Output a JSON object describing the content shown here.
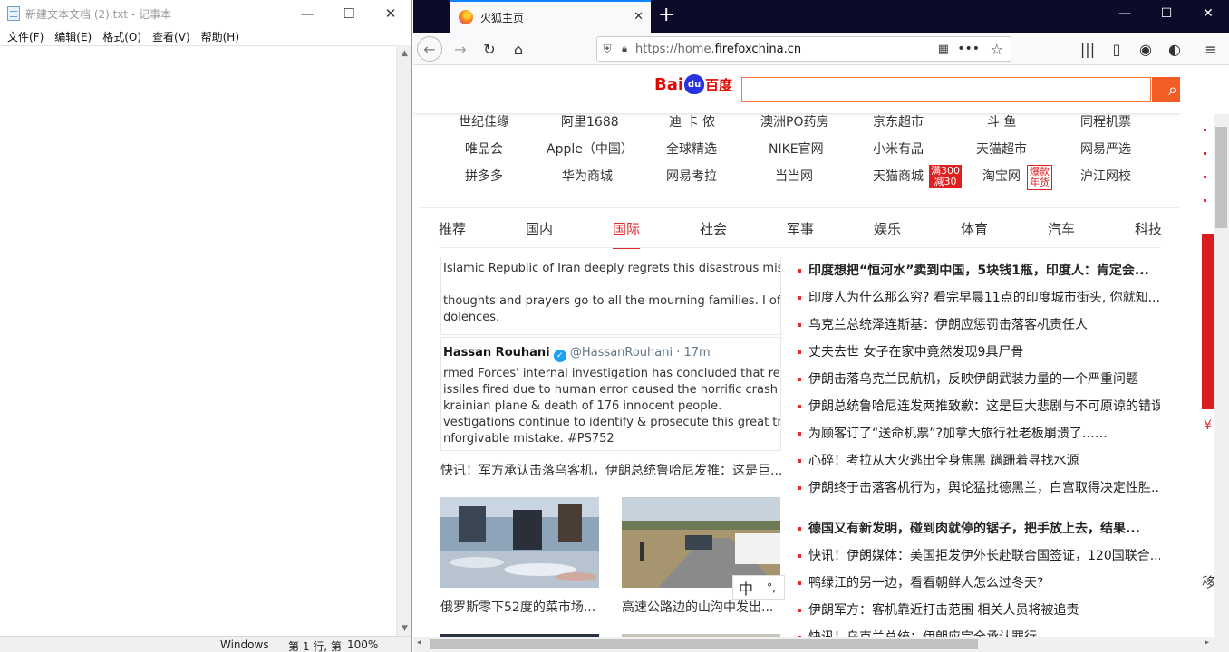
{
  "notepad": {
    "title": "新建文本文档 (2).txt - 记事本",
    "menu": [
      "文件(F)",
      "编辑(E)",
      "格式(O)",
      "查看(V)",
      "帮助(H)"
    ],
    "status": {
      "encoding": "Windows (",
      "position": "第 1 行, 第",
      "zoom": "100%"
    }
  },
  "firefox": {
    "tab_title": "火狐主页",
    "url_prefix": "https://home.",
    "url_domain": "firefoxchina.cn",
    "baidu": {
      "logo_left": "Bai",
      "logo_paw": "du",
      "logo_right": "百度"
    },
    "links": [
      [
        "世纪佳缘",
        "阿里1688",
        "迪 卡 侬",
        "澳洲PO药房",
        "京东超市",
        "斗 鱼",
        "同程机票"
      ],
      [
        "唯品会",
        "Apple（中国）",
        "全球精选",
        "NIKE官网",
        "小米有品",
        "天猫超市",
        "网易严选"
      ],
      [
        "拼多多",
        "华为商城",
        "网易考拉",
        "当当网",
        "天猫商城",
        "淘宝网",
        "沪江网校"
      ]
    ],
    "badge_tmall": [
      "满300",
      "减30"
    ],
    "badge_taobao": [
      "爆款",
      "年货"
    ],
    "news_tabs": [
      "推荐",
      "国内",
      "国际",
      "社会",
      "军事",
      "娱乐",
      "体育",
      "汽车",
      "科技"
    ],
    "active_tab": "国际",
    "tweet": {
      "line1": "Islamic Republic of Iran deeply regrets this disastrous mistake",
      "line2": "thoughts and prayers go to all the mourning families. I offer m",
      "line3": "dolences.",
      "name": "Hassan Rouhani",
      "handle": "@HassanRouhani · 17m",
      "body": [
        "rmed Forces' internal investigation has concluded that regretta",
        "issiles fired due to human error caused the horrific crash of th",
        "krainian plane & death of 176 innocent people.",
        "vestigations continue to identify & prosecute this great traged",
        "nforgivable mistake. #PS752"
      ]
    },
    "tweet_caption": "快讯！军方承认击落乌客机，伊朗总统鲁哈尼发推：这是巨...",
    "photo_captions": [
      "俄罗斯零下52度的菜市场...",
      "高速公路边的山沟中发出..."
    ],
    "ime": [
      "中",
      "°,"
    ],
    "news": [
      {
        "t": "印度想把“恒河水”卖到中国，5块钱1瓶，印度人：肯定会...",
        "b": true
      },
      {
        "t": "印度人为什么那么穷? 看完早晨11点的印度城市街头, 你就知...",
        "b": false
      },
      {
        "t": "乌克兰总统泽连斯基：伊朗应惩罚击落客机责任人",
        "b": false
      },
      {
        "t": "丈夫去世 女子在家中竟然发现9具尸骨",
        "b": false
      },
      {
        "t": "伊朗击落乌克兰民航机，反映伊朗武装力量的一个严重问题",
        "b": false
      },
      {
        "t": "伊朗总统鲁哈尼连发两推致歉：这是巨大悲剧与不可原谅的错误",
        "b": false
      },
      {
        "t": "为顾客订了“送命机票”?加拿大旅行社老板崩溃了……",
        "b": false
      },
      {
        "t": "心碎！考拉从大火逃出全身焦黑 蹒跚着寻找水源",
        "b": false
      },
      {
        "t": "伊朗终于击落客机行为，舆论猛批德黑兰，白宫取得决定性胜...",
        "b": false
      },
      {
        "t": "德国又有新发明，碰到肉就停的锯子，把手放上去，结果...",
        "b": true
      },
      {
        "t": "快讯！伊朗媒体：美国拒发伊外长赴联合国签证，120国联合...",
        "b": false
      },
      {
        "t": "鸭绿江的另一边，看看朝鲜人怎么过冬天?",
        "b": false
      },
      {
        "t": "伊朗军方：客机靠近打击范围 相关人员将被追责",
        "b": false
      },
      {
        "t": "快讯！乌克兰总统：伊朗应完全承认罪行",
        "b": false
      }
    ],
    "right_peek": {
      "yen": "¥",
      "move": "移"
    },
    "accent": "#e42b2b",
    "search_button_color": "#f25d25"
  }
}
